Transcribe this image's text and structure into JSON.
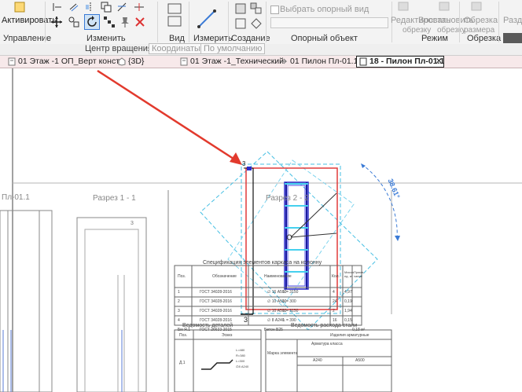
{
  "ribbon": {
    "activate_label": "Активировать",
    "groups": {
      "manage": "Управление",
      "modify": "Изменить",
      "view": "Вид",
      "measure": "Измерить",
      "create": "Создание",
      "ref_object": "Опорный объект",
      "mode": "Режим",
      "crop": "Обрезка"
    },
    "ref_checkbox_label": "Выбрать опорный вид",
    "mode_edit": [
      "Редактировать",
      "обрезку"
    ],
    "mode_restore": [
      "Восстановить",
      "обрезку"
    ],
    "crop_btn": [
      "Обрезка",
      "размера"
    ],
    "split_btn": "Разде"
  },
  "options_bar": {
    "rotation_center_label": "Центр вращения:",
    "coords_button": "Координаты",
    "default_button": "По умолчанию"
  },
  "tabs": [
    {
      "label": "01 Этаж -1 ОП_Верт констр",
      "icon": "plan-icon",
      "active": false
    },
    {
      "label": "{3D}",
      "icon": "3d-view-icon",
      "active": false
    },
    {
      "label": "01 Этаж -1_Технический",
      "icon": "plan-icon",
      "active": false
    },
    {
      "label": "01 Пилон Пл-01.1",
      "icon": "section-icon",
      "active": false
    },
    {
      "label": "18 - Пилон Пл-01.1",
      "icon": "sheet-icon",
      "active": true
    }
  ],
  "drawing": {
    "title_left": "Пл-01.1",
    "title_section1": "Разрез 1 - 1",
    "title_section2": "Разрез 2 - 2",
    "rotation_angle": "38.61°",
    "section_marker_1": "3",
    "section_marker_2": "3",
    "marker_small": "3",
    "spec_title": "Спецификация элементов каркаса на колонну",
    "spec_headers": [
      "Поз.",
      "Обозначение",
      "Наименование",
      "Кол.",
      "Масса ед. кг",
      "Приме- чание"
    ],
    "spec_rows": [
      [
        "1",
        "ГОСТ 34028-2016",
        "∅ 16 А500",
        "L = 3150",
        "4",
        "4,97"
      ],
      [
        "2",
        "ГОСТ 34028-2016",
        "∅ 10 А500",
        "L = 300",
        "24",
        "0,19"
      ],
      [
        "3",
        "ГОСТ 34028-2016",
        "∅ 10 А500",
        "L = 3150",
        "2",
        "1,94"
      ],
      [
        "4",
        "ГОСТ 34028-2016",
        "∅ 8 А240",
        "L = 390",
        "16",
        "0,15"
      ],
      [
        "Бм Я.1",
        "ГОСТ 26633-2015",
        "Бетон В25",
        "",
        "",
        "0,18 м³"
      ]
    ],
    "ved1_title": "Ведомость деталей",
    "ved2_title": "Ведомость расхода стали",
    "ved1_headers": [
      "Поз.",
      "Эскиз"
    ],
    "ved1_row_pos": "Д.1",
    "ved1_dims": [
      "L=480",
      "R=380",
      "L=300",
      "∅8 А240"
    ],
    "ved2_sub": "Изделия арматурные",
    "ved2_sub2": "Арматура класса",
    "ved2_mark": "Марка элемента",
    "ved2_cols": [
      "А240",
      "А500"
    ]
  },
  "colors": {
    "ribbon_bg": "#f3f3f3",
    "tabs_bg": "#f7e9ea",
    "crop_red": "#e03a3a",
    "rotate_cyan": "#45bfe3",
    "rebar_blue": "#2c2ccc",
    "arrow_red": "#e23a2d"
  }
}
